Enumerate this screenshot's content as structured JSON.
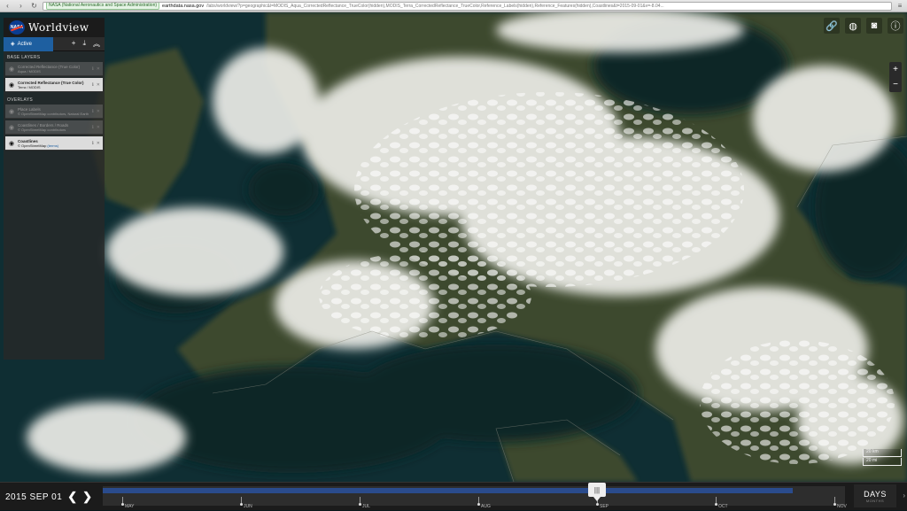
{
  "browser": {
    "site_badge": "NASA (National Aeronautics and Space Administration)",
    "url_host": "earthdata.nasa.gov",
    "url_path": "/labs/worldview/?p=geographic&l=MODIS_Aqua_CorrectedReflectance_TrueColor(hidden),MODIS_Terra_CorrectedReflectance_TrueColor,Reference_Labels(hidden),Reference_Features(hidden),Coastlines&t=2015-09-01&v=-8.04..."
  },
  "app": {
    "title": "Worldview",
    "logo": "NASA"
  },
  "tabs": {
    "active_label": "Active"
  },
  "base_layers": {
    "title": "BASE LAYERS",
    "items": [
      {
        "name": "Corrected Reflectance (True Color)",
        "source": "Aqua / MODIS",
        "visible": false
      },
      {
        "name": "Corrected Reflectance (True Color)",
        "source": "Terra / MODIS",
        "visible": true
      }
    ]
  },
  "overlays": {
    "title": "OVERLAYS",
    "items": [
      {
        "name": "Place Labels",
        "source": "© OpenStreetMap contributors, Natural Earth",
        "visible": false
      },
      {
        "name": "Coastlines / Borders / Roads",
        "source": "© OpenStreetMap contributors",
        "visible": false
      },
      {
        "name": "Coastlines",
        "source": "© OpenStreetMap",
        "link": "(terms)",
        "visible": true
      }
    ]
  },
  "scale": {
    "km": "20 km",
    "mi": "20 mi"
  },
  "timeline": {
    "date": "2015 SEP 01",
    "zoom_level": "DAYS",
    "zoom_sub": "MONTHS",
    "months": [
      "MAY",
      "JUN",
      "JUL",
      "AUG",
      "SEP",
      "OCT",
      "NOV"
    ],
    "selected_month_index": 4,
    "filled_fraction": 0.93
  },
  "colors": {
    "accent": "#1e5fa0",
    "timeline_fill": "#2a4b8c",
    "sea": "#0f2e33",
    "land": "#3d4a2c",
    "cloud": "#f2f2ee"
  }
}
